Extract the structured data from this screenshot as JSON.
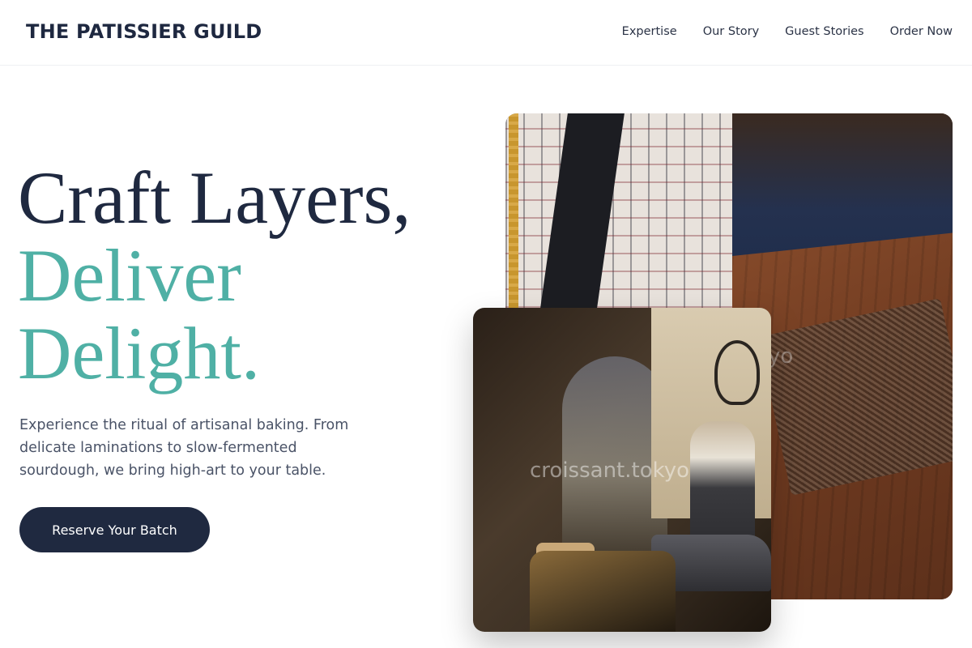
{
  "header": {
    "brand": "THE PATISSIER GUILD",
    "nav": [
      {
        "label": "Expertise"
      },
      {
        "label": "Our Story"
      },
      {
        "label": "Guest Stories"
      },
      {
        "label": "Order Now"
      }
    ]
  },
  "hero": {
    "headline_line1": "Craft Layers,",
    "headline_line2": "Deliver",
    "headline_line3": "Delight.",
    "subtext": "Experience the ritual of artisanal baking. From delicate laminations to slow-fermented sourdough, we bring high-art to your table.",
    "cta_label": "Reserve Your Batch"
  },
  "images": {
    "watermark_back": "yo",
    "watermark_front": "croissant.tokyo"
  },
  "colors": {
    "primary": "#1f2940",
    "accent": "#4fb0a5",
    "body_text": "#4a5367"
  }
}
